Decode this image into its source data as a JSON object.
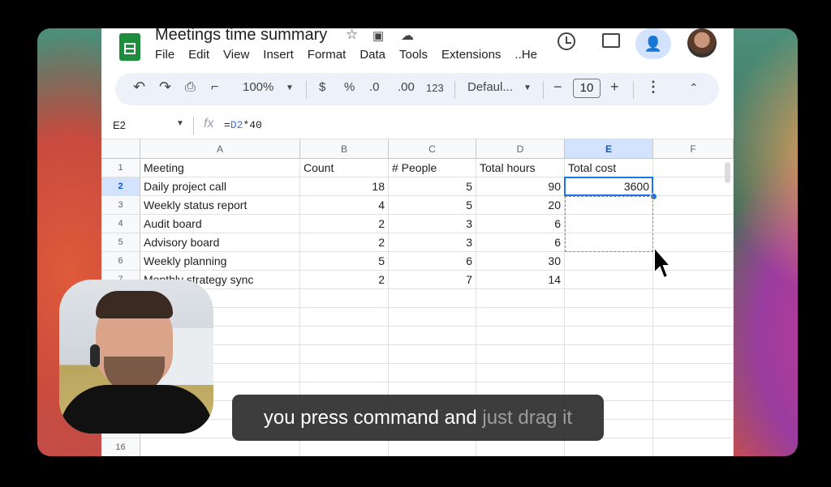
{
  "doc": {
    "title": "Meetings time summary"
  },
  "menu": [
    "File",
    "Edit",
    "View",
    "Insert",
    "Format",
    "Data",
    "Tools",
    "Extensions",
    "..He"
  ],
  "toolbar": {
    "zoom": "100%",
    "currency": "$",
    "percent": "%",
    "dec_decrease": ".0",
    "dec_increase": ".00",
    "number_format": "123",
    "font": "Defaul...",
    "font_size": "10",
    "minus": "−",
    "plus": "+"
  },
  "formula_bar": {
    "name_box": "E2",
    "fx": "fx",
    "formula_prefix": "=",
    "formula_ref": "D2",
    "formula_suffix": "*40"
  },
  "columns": [
    "A",
    "B",
    "C",
    "D",
    "E",
    "F"
  ],
  "selected_column": "E",
  "rows": [
    {
      "num": "1",
      "cells": [
        "Meeting",
        "Count",
        "# People",
        "Total hours",
        "Total cost",
        ""
      ]
    },
    {
      "num": "2",
      "cells": [
        "Daily project call",
        "18",
        "5",
        "90",
        "3600",
        ""
      ]
    },
    {
      "num": "3",
      "cells": [
        "Weekly status report",
        "4",
        "5",
        "20",
        "",
        ""
      ]
    },
    {
      "num": "4",
      "cells": [
        "Audit board",
        "2",
        "3",
        "6",
        "",
        ""
      ]
    },
    {
      "num": "5",
      "cells": [
        "Advisory board",
        "2",
        "3",
        "6",
        "",
        ""
      ]
    },
    {
      "num": "6",
      "cells": [
        "Weekly planning",
        "5",
        "6",
        "30",
        "",
        ""
      ]
    },
    {
      "num": "7",
      "cells": [
        "Monthly strategy sync",
        "2",
        "7",
        "14",
        "",
        ""
      ]
    },
    {
      "num": "",
      "cells": [
        "",
        "",
        "",
        "",
        "",
        ""
      ]
    },
    {
      "num": "",
      "cells": [
        "",
        "",
        "",
        "",
        "",
        ""
      ]
    },
    {
      "num": "",
      "cells": [
        "",
        "",
        "",
        "",
        "",
        ""
      ]
    },
    {
      "num": "",
      "cells": [
        "",
        "",
        "",
        "",
        "",
        ""
      ]
    },
    {
      "num": "",
      "cells": [
        "",
        "",
        "",
        "",
        "",
        ""
      ]
    },
    {
      "num": "",
      "cells": [
        "",
        "",
        "",
        "",
        "",
        ""
      ]
    },
    {
      "num": "",
      "cells": [
        "",
        "",
        "",
        "",
        "",
        ""
      ]
    },
    {
      "num": "",
      "cells": [
        "",
        "",
        "",
        "",
        "",
        ""
      ]
    },
    {
      "num": "16",
      "cells": [
        "",
        "",
        "",
        "",
        "",
        ""
      ]
    }
  ],
  "caption": {
    "main": "you press command and",
    "upcoming": "just drag it"
  },
  "colors": {
    "accent": "#1a73e8",
    "selected_header": "#d3e3fd",
    "caption_bg": "#2d2d2d"
  }
}
